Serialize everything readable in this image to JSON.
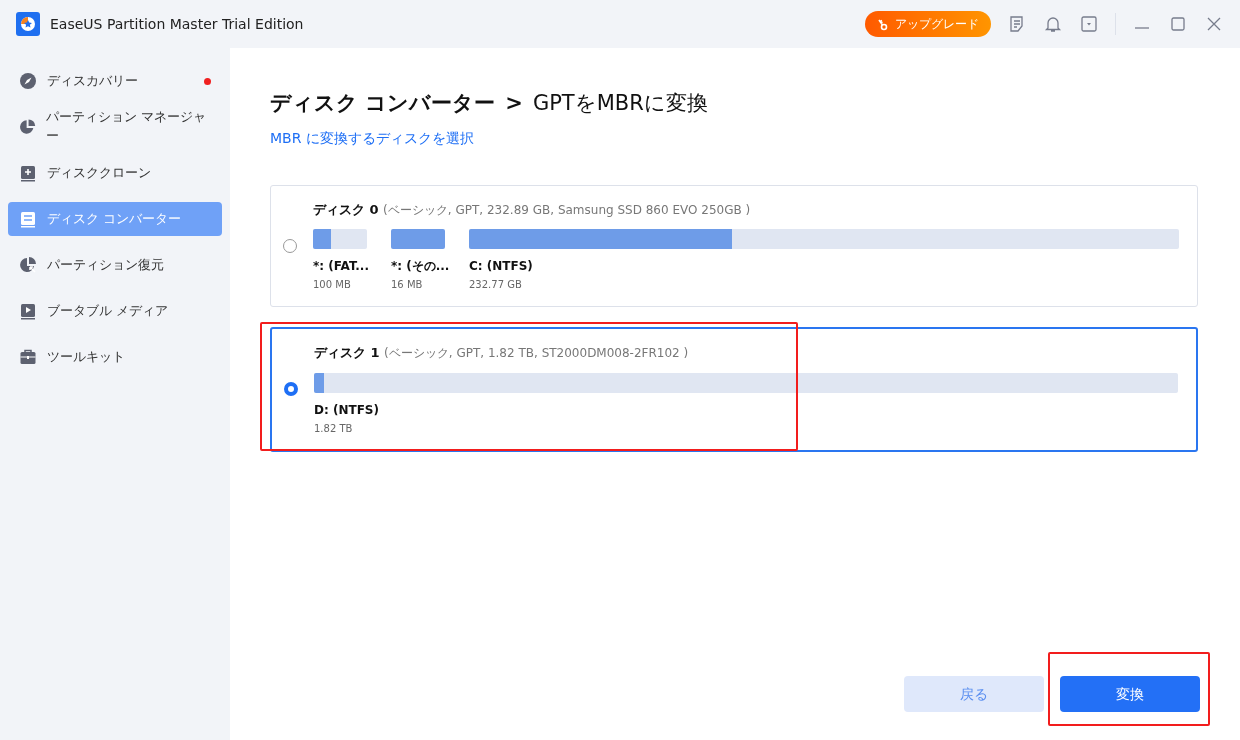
{
  "window": {
    "title": "EaseUS Partition Master Trial Edition"
  },
  "toolbar": {
    "upgrade": "アップグレード"
  },
  "sidebar": {
    "items": [
      {
        "label": "ディスカバリー",
        "selected": false,
        "badge": true
      },
      {
        "label": "パーティション マネージャー",
        "selected": false,
        "badge": false
      },
      {
        "label": "ディスククローン",
        "selected": false,
        "badge": false
      },
      {
        "label": "ディスク コンバーター",
        "selected": true,
        "badge": false
      },
      {
        "label": "パーティション復元",
        "selected": false,
        "badge": false
      },
      {
        "label": "ブータブル メディア",
        "selected": false,
        "badge": false
      },
      {
        "label": "ツールキット",
        "selected": false,
        "badge": false
      }
    ]
  },
  "breadcrumb": [
    "ディスク コンバーター",
    ">",
    "GPTをMBRに変換"
  ],
  "subtitle": "MBR に変換するディスクを選択",
  "disks": [
    {
      "name": "ディスク 0",
      "details": "(ベーシック, GPT, 232.89 GB, Samsung SSD 860 EVO 250GB )",
      "selected": false,
      "highlighted": false,
      "partitions": [
        {
          "kind": "small",
          "label": "*: (FAT...",
          "size": "100 MB",
          "level": 0.33
        },
        {
          "kind": "small",
          "label": "*: (その...",
          "size": "16 MB",
          "level": 1
        },
        {
          "kind": "main",
          "label": "C: (NTFS)",
          "size": "232.77 GB",
          "level": 0.37
        }
      ]
    },
    {
      "name": "ディスク 1",
      "details": "(ベーシック, GPT, 1.82 TB, ST2000DM008-2FR102 )",
      "selected": true,
      "highlighted": true,
      "partitions": [
        {
          "kind": "main",
          "label": "D: (NTFS)",
          "size": "1.82 TB",
          "level": 0.011
        }
      ]
    }
  ],
  "buttons": {
    "back": "戻る",
    "convert": "変換",
    "convert_highlighted": true
  }
}
